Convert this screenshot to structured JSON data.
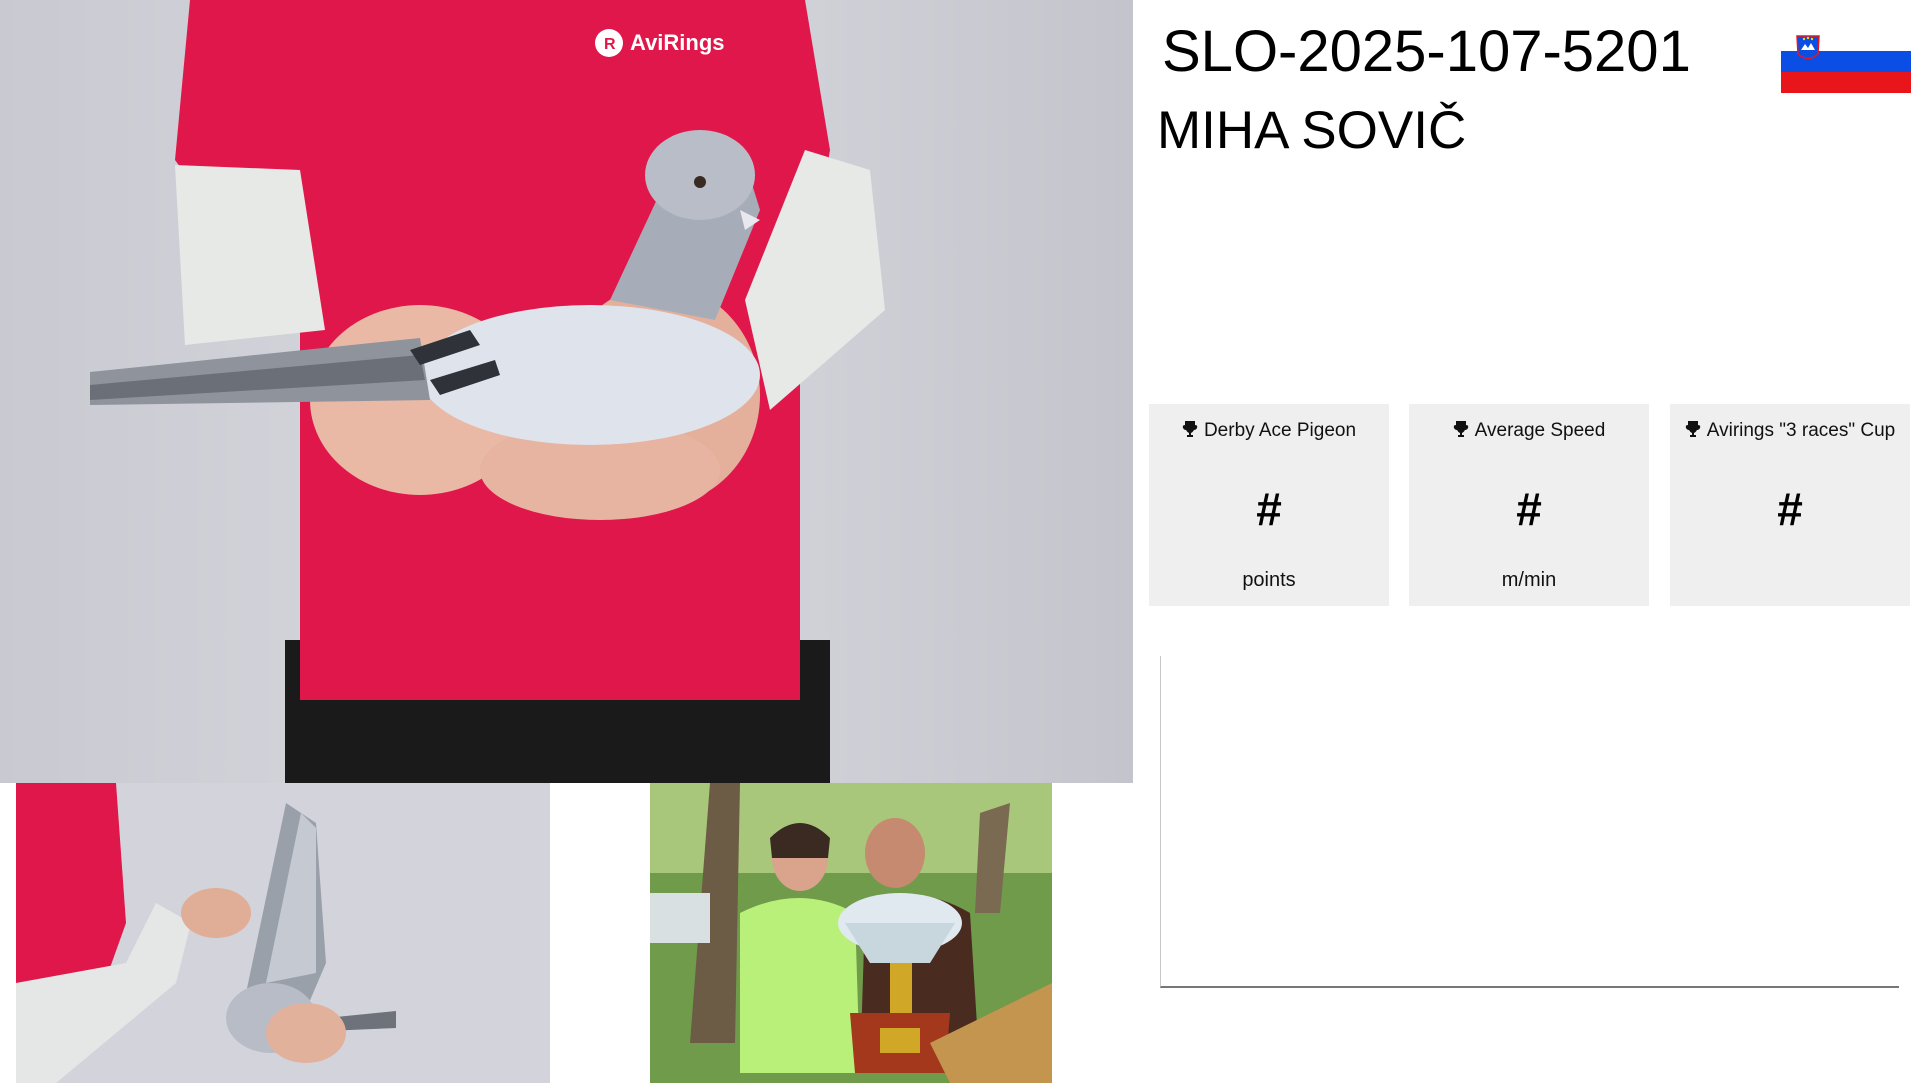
{
  "pigeon": {
    "ring_number": "SLO-2025-107-5201",
    "owner_name": "MIHA SOVIČ",
    "country_flag": "slovenia-flag"
  },
  "photos": {
    "main_shirt_logo": "AviRings"
  },
  "stats": [
    {
      "label": "Derby Ace Pigeon",
      "value": "#",
      "unit": "points",
      "icon": "trophy-icon"
    },
    {
      "label": "Average Speed",
      "value": "#",
      "unit": "m/min",
      "icon": "trophy-icon"
    },
    {
      "label": "Avirings \"3 races\" Cup",
      "value": "#",
      "unit": "",
      "icon": "trophy-icon"
    }
  ],
  "colors": {
    "card_bg": "#efefef",
    "flag_white": "#ffffff",
    "flag_blue": "#0b4ee6",
    "flag_red": "#e8161b"
  }
}
